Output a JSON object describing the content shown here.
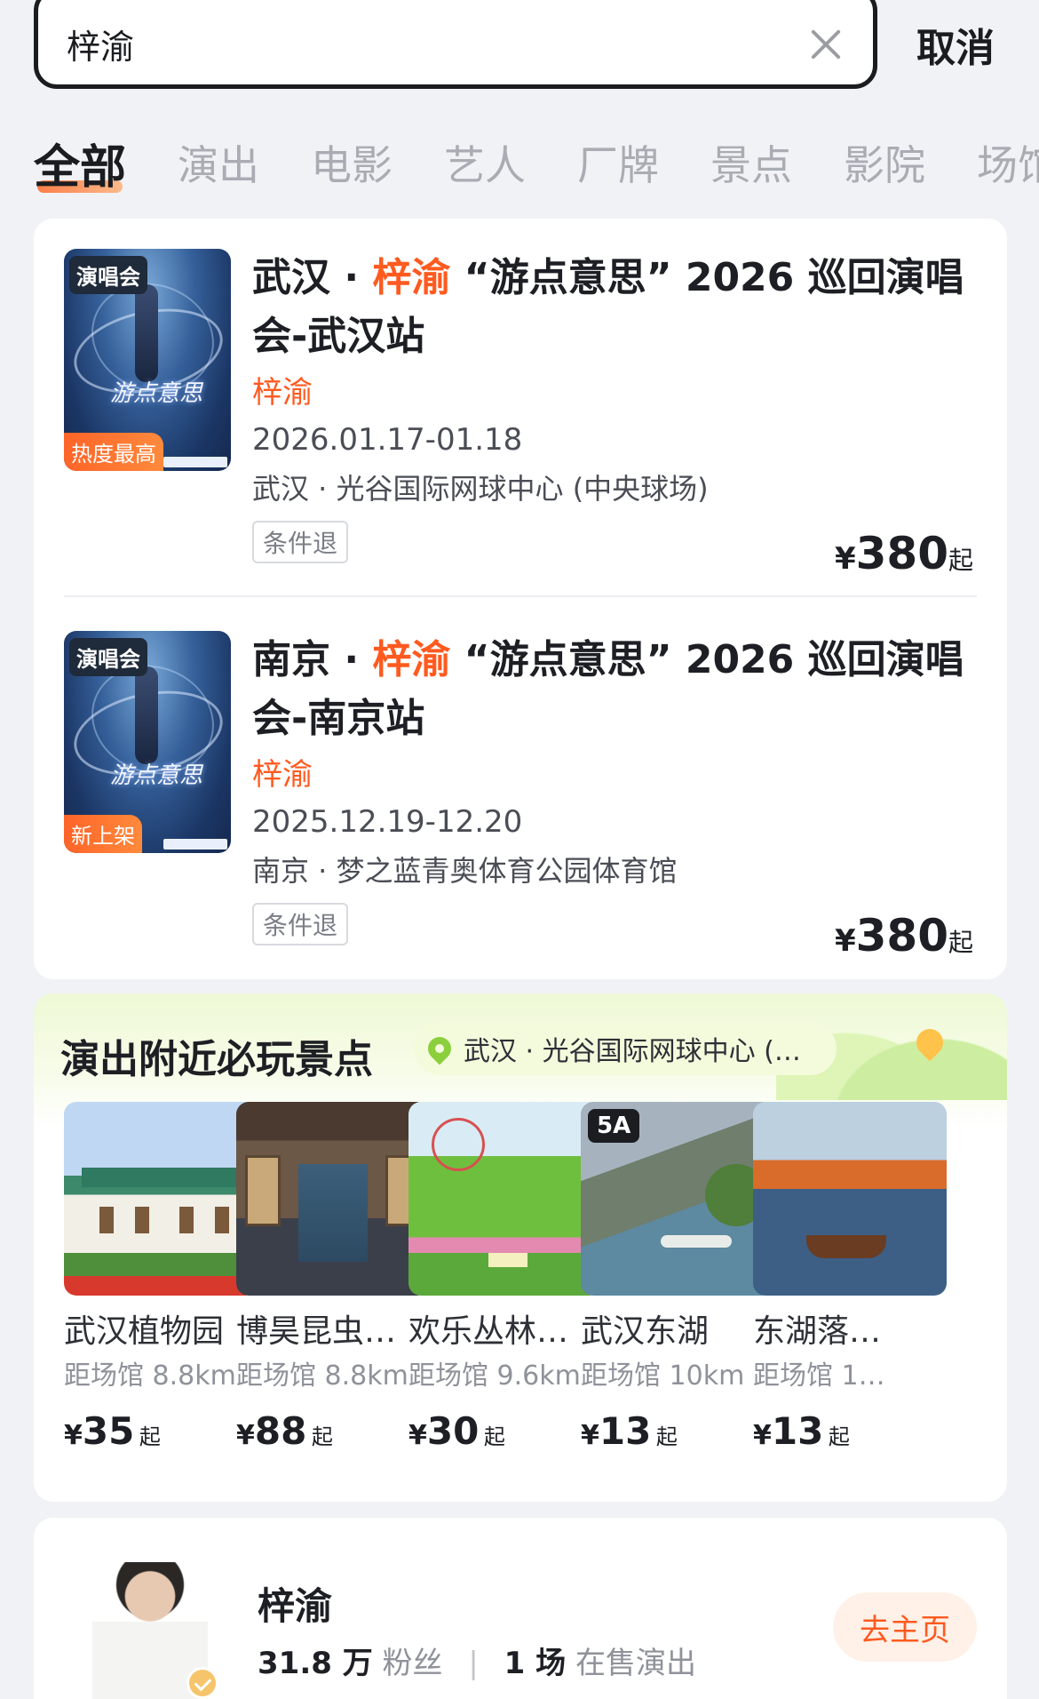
{
  "search": {
    "query": "梓渝",
    "cancel_label": "取消"
  },
  "tabs": [
    "全部",
    "演出",
    "电影",
    "艺人",
    "厂牌",
    "景点",
    "影院",
    "场馆"
  ],
  "events": [
    {
      "poster_tag": "演唱会",
      "poster_badge": "热度最高",
      "poster_brand": "游点意思",
      "title_prefix": "武汉 · ",
      "title_highlight": "梓渝",
      "title_suffix": " “游点意思” 2026 巡回演唱会-武汉站",
      "artist": "梓渝",
      "date": "2026.01.17-01.18",
      "venue": "武汉 · 光谷国际网球中心 (中央球场)",
      "refund": "条件退",
      "price_symbol": "¥",
      "price": "380",
      "price_suffix": "起"
    },
    {
      "poster_tag": "演唱会",
      "poster_badge": "新上架",
      "poster_brand": "游点意思",
      "title_prefix": "南京 · ",
      "title_highlight": "梓渝",
      "title_suffix": " “游点意思” 2026 巡回演唱会-南京站",
      "artist": "梓渝",
      "date": "2025.12.19-12.20",
      "venue": "南京 · 梦之蓝青奥体育公园体育馆",
      "refund": "条件退",
      "price_symbol": "¥",
      "price": "380",
      "price_suffix": "起"
    }
  ],
  "nearby": {
    "title": "演出附近必玩景点",
    "venue": "武汉 · 光谷国际网球中心 (…",
    "spots": [
      {
        "name": "武汉植物园",
        "distance": "距场馆 8.8km",
        "price_symbol": "¥",
        "price": "35",
        "price_suffix": "起",
        "badge": ""
      },
      {
        "name": "博昊昆虫…",
        "distance": "距场馆 8.8km",
        "price_symbol": "¥",
        "price": "88",
        "price_suffix": "起",
        "badge": ""
      },
      {
        "name": "欢乐丛林…",
        "distance": "距场馆 9.6km",
        "price_symbol": "¥",
        "price": "30",
        "price_suffix": "起",
        "badge": ""
      },
      {
        "name": "武汉东湖",
        "distance": "距场馆 10km",
        "price_symbol": "¥",
        "price": "13",
        "price_suffix": "起",
        "badge": "5A"
      },
      {
        "name": "东湖落…",
        "distance": "距场馆 1…",
        "price_symbol": "¥",
        "price": "13",
        "price_suffix": "起",
        "badge": ""
      }
    ]
  },
  "artist": {
    "name": "梓渝",
    "fans_count": "31.8 万",
    "fans_label": "粉丝",
    "shows_count": "1 场",
    "shows_label": "在售演出",
    "home_button": "去主页"
  },
  "colors": {
    "accent": "#ff5a1f",
    "background": "#f1f2f6",
    "card": "#ffffff",
    "nearby_header": "#eef9d6"
  }
}
